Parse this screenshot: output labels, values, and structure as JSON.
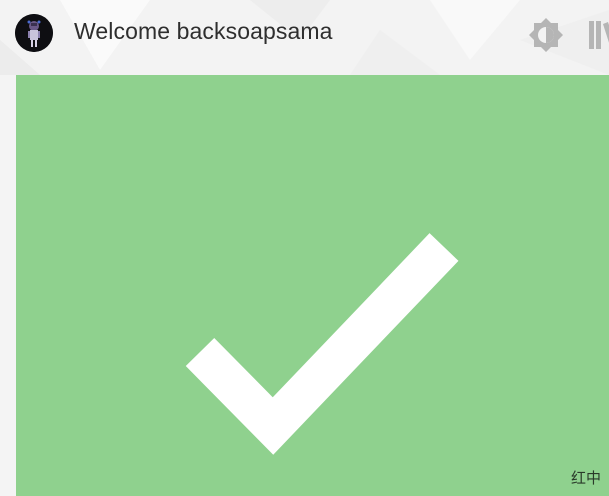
{
  "header": {
    "welcome_text": "Welcome backsoapsama",
    "avatar_icon": "user-avatar",
    "theme_toggle_icon": "brightness-icon",
    "library_icon": "library-icon"
  },
  "main": {
    "status_icon": "checkmark-icon",
    "panel_color": "#8fd18e"
  },
  "ime_indicator": "红中"
}
